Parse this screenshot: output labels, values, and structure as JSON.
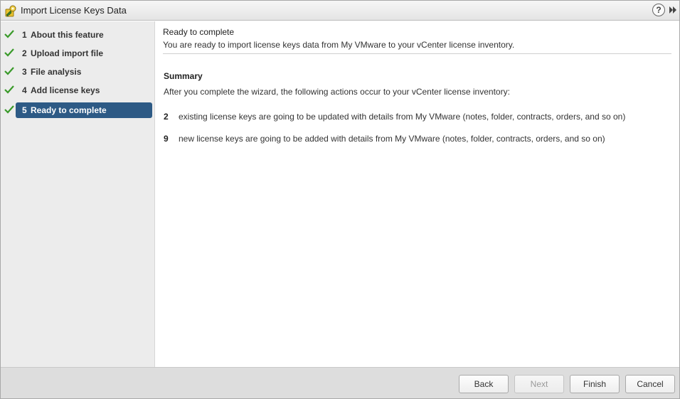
{
  "window": {
    "title": "Import License Keys Data",
    "help_label": "?",
    "icons": {
      "title": "key-icon",
      "help": "help-icon",
      "expand": "double-chevron-right-icon"
    }
  },
  "sidebar": {
    "steps": [
      {
        "number": "1",
        "label": "About this feature",
        "completed": true,
        "active": false
      },
      {
        "number": "2",
        "label": "Upload import file",
        "completed": true,
        "active": false
      },
      {
        "number": "3",
        "label": "File analysis",
        "completed": true,
        "active": false
      },
      {
        "number": "4",
        "label": "Add license keys",
        "completed": true,
        "active": false
      },
      {
        "number": "5",
        "label": "Ready to complete",
        "completed": true,
        "active": true
      }
    ]
  },
  "main": {
    "title": "Ready to complete",
    "description": "You are ready to import license keys data from My VMware to your vCenter license inventory.",
    "summary": {
      "title": "Summary",
      "description": "After you complete the wizard, the following actions occur to your vCenter license inventory:",
      "items": [
        {
          "count": "2",
          "text": "existing license keys are going to be updated with details from My VMware (notes, folder, contracts, orders, and so on)"
        },
        {
          "count": "9",
          "text": "new license keys are going to be added with details from My VMware (notes, folder, contracts, orders, and so on)"
        }
      ]
    }
  },
  "footer": {
    "buttons": {
      "back": "Back",
      "next": "Next",
      "finish": "Finish",
      "cancel": "Cancel"
    }
  },
  "colors": {
    "active_step": "#2d5a85",
    "check": "#3a9a2a",
    "sidebar_bg": "#ececec",
    "footer_bg": "#dddddd"
  }
}
